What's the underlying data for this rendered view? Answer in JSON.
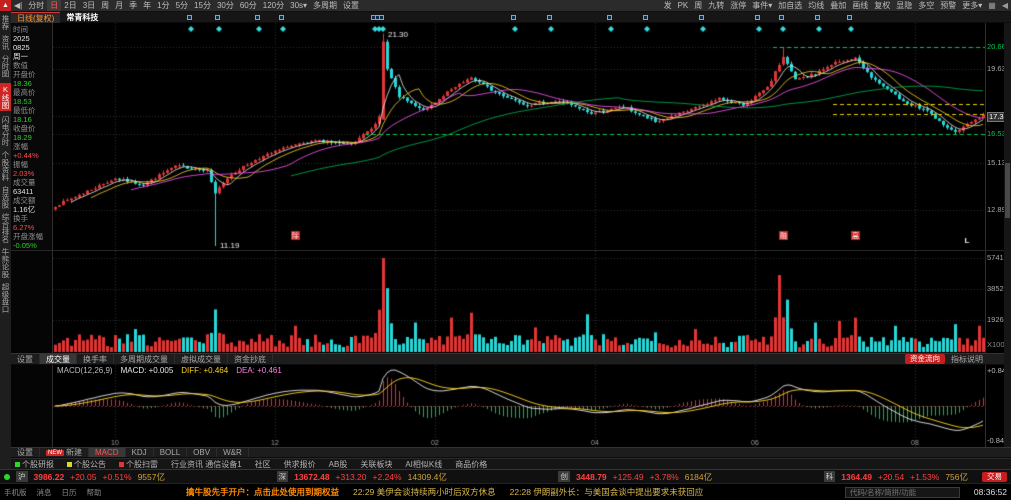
{
  "toolbar": {
    "logo_glyph": "▲",
    "back_icon": "◀|",
    "periods": [
      "分时",
      "日",
      "2日",
      "3日",
      "周",
      "月",
      "季",
      "年",
      "1分",
      "5分",
      "15分",
      "30分",
      "60分",
      "120分",
      "30s▾"
    ],
    "active_period": "日",
    "left_extras": [
      "多周期",
      "设置"
    ],
    "right_items": [
      "发",
      "PK",
      "周",
      "九转",
      "涨停",
      "事件▾",
      "加自选",
      "均线",
      "叠加",
      "画线",
      "复权",
      "显隐",
      "多空",
      "预警",
      "更多▾"
    ],
    "window_icons": [
      "▦",
      "◀"
    ]
  },
  "titlebar": {
    "tab": "日线(复权)",
    "stock": "常青科技"
  },
  "sidebar": {
    "items": [
      "推荐",
      "资讯",
      "分时图",
      "K线图",
      "闪电分时",
      "个股资料",
      "自选股",
      "综合排名",
      "牛熊论股",
      "超级盘口"
    ],
    "active_index": 3
  },
  "info_panel": {
    "time_label": "时间",
    "date_lines": [
      "2025",
      "0825",
      "周一"
    ],
    "section_label": "数值",
    "fields": [
      {
        "label": "开盘价",
        "value": "18.36",
        "color": "#26d126"
      },
      {
        "label": "最高价",
        "value": "18.53",
        "color": "#26d126"
      },
      {
        "label": "最低价",
        "value": "18.16",
        "color": "#26d126"
      },
      {
        "label": "收盘价",
        "value": "18.29",
        "color": "#26d126"
      },
      {
        "label": "涨幅",
        "value": "+0.44%",
        "color": "#ff4a4a"
      },
      {
        "label": "振幅",
        "value": "2.03%",
        "color": "#ff4a4a"
      },
      {
        "label": "成交量",
        "value": "63411",
        "color": "#e0e0e0"
      },
      {
        "label": "成交额",
        "value": "1.16亿",
        "color": "#e0e0e0"
      },
      {
        "label": "换手",
        "value": "6.27%",
        "color": "#ff4a4a"
      },
      {
        "label": "开盘涨幅",
        "value": "-0.05%",
        "color": "#26d126"
      }
    ]
  },
  "chart_data": {
    "type": "candlestick",
    "symbol": "常青科技",
    "period": "日线(复权)",
    "n": 233,
    "seed": 7,
    "price_range": [
      11.0,
      21.8
    ],
    "close_anchors": [
      [
        0,
        13.1
      ],
      [
        8,
        13.8
      ],
      [
        15,
        14.4
      ],
      [
        22,
        14.1
      ],
      [
        30,
        15.0
      ],
      [
        38,
        14.8
      ],
      [
        40,
        13.7
      ],
      [
        44,
        14.6
      ],
      [
        50,
        15.3
      ],
      [
        58,
        15.9
      ],
      [
        66,
        16.2
      ],
      [
        74,
        16.0
      ],
      [
        79,
        16.8
      ],
      [
        81,
        17.3
      ],
      [
        82,
        20.9
      ],
      [
        83,
        19.6
      ],
      [
        86,
        18.3
      ],
      [
        92,
        17.6
      ],
      [
        98,
        18.5
      ],
      [
        104,
        19.2
      ],
      [
        110,
        18.5
      ],
      [
        118,
        17.9
      ],
      [
        126,
        18.1
      ],
      [
        134,
        17.5
      ],
      [
        142,
        17.8
      ],
      [
        150,
        17.1
      ],
      [
        158,
        17.6
      ],
      [
        166,
        18.2
      ],
      [
        172,
        17.9
      ],
      [
        178,
        18.7
      ],
      [
        182,
        20.2
      ],
      [
        185,
        19.1
      ],
      [
        190,
        19.4
      ],
      [
        196,
        20.0
      ],
      [
        200,
        20.1
      ],
      [
        204,
        19.2
      ],
      [
        208,
        18.6
      ],
      [
        213,
        18.0
      ],
      [
        218,
        17.6
      ],
      [
        222,
        17.0
      ],
      [
        225,
        16.6
      ],
      [
        228,
        17.0
      ],
      [
        232,
        17.4
      ]
    ],
    "specials": {
      "40": {
        "low": 11.19
      },
      "82": {
        "high": 21.3,
        "open": 17.2
      },
      "182": {
        "high": 20.66
      },
      "225": {
        "low": 16.53
      }
    },
    "callouts": [
      {
        "i": 82,
        "price": 21.3,
        "text": "21.30",
        "pos": "above"
      },
      {
        "i": 40,
        "price": 11.19,
        "text": "11.19",
        "pos": "below"
      }
    ],
    "dashed_lines": [
      {
        "price": 16.53,
        "from": 78,
        "to": 233,
        "color": "#00c850"
      },
      {
        "price": 20.66,
        "from": 180,
        "to": 233,
        "color": "#00c850"
      },
      {
        "price": 17.95,
        "from": 195,
        "to": 233,
        "color": "#e8d000"
      },
      {
        "price": 17.45,
        "from": 195,
        "to": 233,
        "color": "#e8d000"
      }
    ],
    "y_axis_labels": [
      {
        "text": "20.66",
        "price": 20.66,
        "color": "#00c850"
      },
      {
        "text": "19.63",
        "price": 19.63,
        "color": "#aaaaaa"
      },
      {
        "text": "17.39",
        "price": 17.39,
        "color": "#ffffff",
        "boxed": true
      },
      {
        "text": "16.53",
        "price": 16.53,
        "color": "#00c850"
      },
      {
        "text": "15.13",
        "price": 15.13,
        "color": "#aaaaaa"
      },
      {
        "text": "12.89",
        "price": 12.89,
        "color": "#aaaaaa"
      }
    ],
    "x_axis_labels": [
      {
        "i": 15,
        "text": "10"
      },
      {
        "i": 55,
        "text": "12"
      },
      {
        "i": 95,
        "text": "02"
      },
      {
        "i": 135,
        "text": "04"
      },
      {
        "i": 175,
        "text": "06"
      },
      {
        "i": 215,
        "text": "08"
      }
    ],
    "event_marker_indices": [
      34,
      41,
      51,
      57,
      80,
      81,
      82,
      115,
      124,
      139,
      148,
      162,
      176,
      182,
      191,
      199
    ],
    "flag_markers": [
      {
        "i": 60,
        "char": "除"
      },
      {
        "i": 182,
        "char": "融"
      },
      {
        "i": 200,
        "char": "高"
      }
    ],
    "l_marker_index": 228,
    "ma_periods": [
      5,
      10,
      20,
      60
    ],
    "ma_colors": [
      "#e8e8e8",
      "#ffd21e",
      "#ff55ff",
      "#00b450"
    ],
    "up_color": "#e23535",
    "down_color": "#26d7d7",
    "volume_anchors": {
      "20": 1400,
      "40": 2600,
      "60": 1600,
      "82": 5741,
      "83": 3900,
      "90": 1800,
      "99": 2100,
      "104": 2400,
      "120": 1500,
      "133": 2300,
      "150": 1200,
      "160": 1400,
      "181": 4700,
      "183": 3200,
      "190": 1800,
      "196": 1900,
      "200": 2100,
      "210": 1600,
      "225": 1700,
      "231": 1600
    },
    "volume_base": [
      280,
      1100
    ],
    "volume_axis": [
      {
        "text": "5741",
        "v": 5741
      },
      {
        "text": "3852",
        "v": 3852
      },
      {
        "text": "1926",
        "v": 1926
      }
    ],
    "volume_unit": "X100",
    "macd_axis_top": "+0.845",
    "macd_axis_bottom": "-0.845"
  },
  "volume_tabs": {
    "items": [
      "设置",
      "成交量",
      "换手率",
      "多周期成交量",
      "虚拟成交量",
      "资金抄底"
    ],
    "active": "成交量",
    "right_button": "资金流向",
    "right_label": "指标说明"
  },
  "macd_header": {
    "name": "MACD(12,26,9)",
    "values": [
      {
        "text": "MACD: +0.005",
        "color": "#e8e8e8"
      },
      {
        "text": "DIFF: +0.464",
        "color": "#ffd21e"
      },
      {
        "text": "DEA: +0.461",
        "color": "#ff7ee3"
      }
    ]
  },
  "indicator_tabs": {
    "settings": "设置",
    "new_badge": "NEW",
    "new_label": "新建",
    "items": [
      "MACD",
      "KDJ",
      "BOLL",
      "OBV",
      "W&R"
    ],
    "active": "MACD"
  },
  "links_row": {
    "items": [
      {
        "text": "个股研报",
        "icon": "#2ad82a"
      },
      {
        "text": "个股公告",
        "icon": "#d8d82a"
      },
      {
        "text": "个股扫雷",
        "icon": "#e23535"
      },
      {
        "text": "行业资讯 通信设备1",
        "icon": ""
      },
      {
        "text": "社区",
        "icon": ""
      },
      {
        "text": "供求报价",
        "icon": ""
      },
      {
        "text": "AB股",
        "icon": ""
      },
      {
        "text": "关联板块",
        "icon": ""
      },
      {
        "text": "AI相似K线",
        "icon": ""
      },
      {
        "text": "商品价格",
        "icon": ""
      }
    ]
  },
  "indices": [
    {
      "name": "沪",
      "value": "3986.22",
      "chg": "+20.05",
      "pct": "+0.51%",
      "amt": "9557亿"
    },
    {
      "name": "深",
      "value": "13672.48",
      "chg": "+313.20",
      "pct": "+2.24%",
      "amt": "14309.4亿"
    },
    {
      "name": "创",
      "value": "3448.79",
      "chg": "+125.49",
      "pct": "+3.78%",
      "amt": "6184亿"
    },
    {
      "name": "科",
      "value": "1364.49",
      "chg": "+20.54",
      "pct": "+1.53%",
      "amt": "756亿"
    }
  ],
  "indices_bar": {
    "trade_button": "交易"
  },
  "ticker": {
    "left_items": [
      "手机版",
      "消息",
      "日历",
      "帮助"
    ],
    "promo": "擒牛股先手开户：点击此处使用到期权益",
    "news1": "22:29 美伊会谈持续两小时后双方休息",
    "news2": "22:28 伊朗副外长：与美国会谈中提出要求未获回应",
    "search_placeholder": "代码/名称/简拼/功能",
    "time": "08:36:52"
  }
}
